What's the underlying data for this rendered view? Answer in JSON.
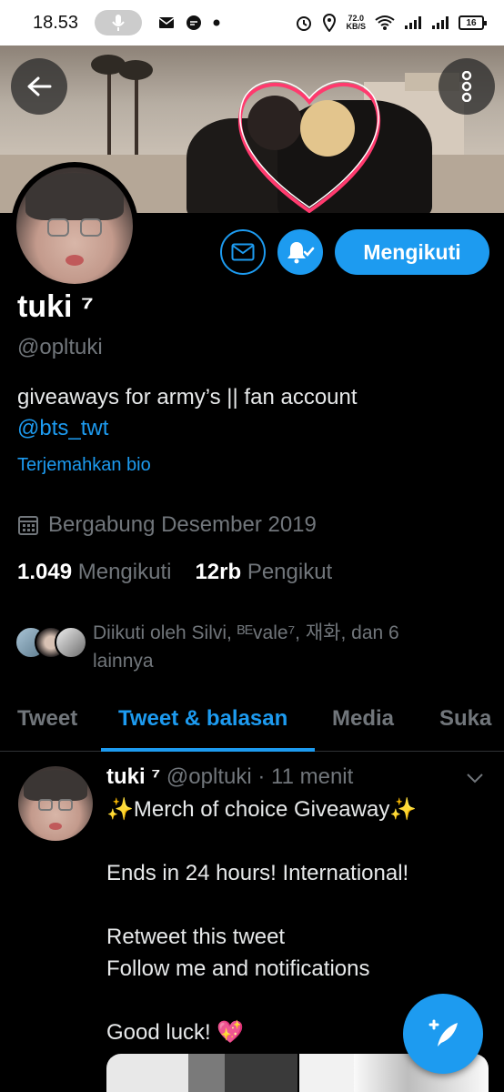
{
  "status_bar": {
    "time": "18.53",
    "speed_value": "72.0",
    "speed_unit": "KB/S",
    "battery": "16"
  },
  "profile": {
    "name": "tuki ⁷",
    "handle": "@opltuki",
    "bio_text": "giveaways for army’s || fan account",
    "bio_mention": "@bts_twt",
    "translate_bio": "Terjemahkan bio",
    "joined": "Bergabung Desember 2019",
    "following_count": "1.049",
    "following_label": "Mengikuti",
    "followers_count": "12rb",
    "followers_label": "Pengikut",
    "followed_by": "Diikuti oleh Silvi, ᴮᴱvale⁷, 재화, dan 6 lainnya"
  },
  "actions": {
    "follow_label": "Mengikuti"
  },
  "tabs": [
    {
      "label": "Tweet",
      "active": false
    },
    {
      "label": "Tweet & balasan",
      "active": true
    },
    {
      "label": "Media",
      "active": false
    },
    {
      "label": "Suka",
      "active": false
    }
  ],
  "tweet": {
    "author_name": "tuki ⁷",
    "author_handle": "@opltuki",
    "separator": "·",
    "time": "11 menit",
    "lines": [
      "✨Merch of choice Giveaway✨",
      "",
      "Ends in 24 hours! International!",
      "",
      "Retweet this tweet",
      "Follow me and notifications",
      "",
      "Good luck! 💖"
    ]
  },
  "colors": {
    "accent": "#1d9bf0",
    "background": "#000000",
    "muted": "#71767b",
    "heart": "#ff3a6e"
  },
  "icons": {
    "back": "arrow-left-icon",
    "more": "more-vertical-icon",
    "mail": "mail-icon",
    "bell": "bell-check-icon",
    "calendar": "calendar-icon",
    "caret": "chevron-down-icon",
    "compose": "compose-tweet-icon"
  }
}
